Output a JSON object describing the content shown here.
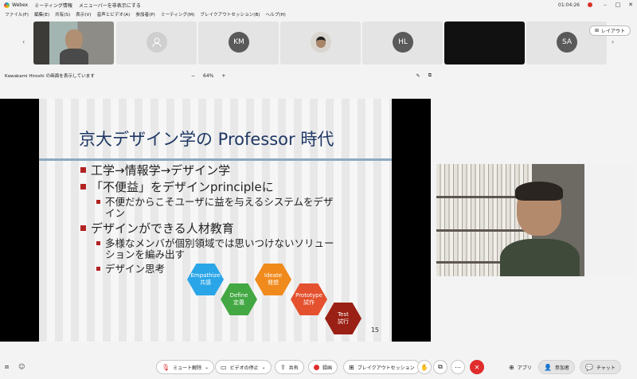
{
  "titlebar": {
    "app_name": "Webex",
    "tab_meeting": "ミーティング情報",
    "tab_hide_menu": "メニューバーを非表示にする",
    "time": "01:04:26"
  },
  "menubar": {
    "items": [
      "ファイル(F)",
      "編集(E)",
      "共有(S)",
      "表示(V)",
      "音声とビデオ(A)",
      "参加者(P)",
      "ミーティング(M)",
      "ブレイクアウトセッション(B)",
      "ヘルプ(H)"
    ]
  },
  "participants": {
    "tiles": [
      {
        "initials": ""
      },
      {
        "initials": "KM"
      },
      {
        "initials": ""
      },
      {
        "initials": "HL"
      },
      {
        "initials": ""
      },
      {
        "initials": "SA"
      }
    ],
    "layout_label": "レイアウト"
  },
  "share": {
    "status": "Kawakami Hiroshi の画面を表示しています",
    "zoom_level": "64%",
    "zoom_out": "−",
    "zoom_in": "+"
  },
  "slide": {
    "title": "京大デザイン学の Professor 時代",
    "bullets": [
      "工学→情報学→デザイン学",
      "「不便益」をデザインprincipleに",
      "デザインができる人材教育"
    ],
    "sub_bullets": [
      "不便だからこそユーザに益を与えるシステムをデザイン",
      "多様なメンバが個別領域では思いつけないソリューションを編み出す",
      "デザイン思考"
    ],
    "sub_line1": "不便だからこそユーザに益を与えるシステムをデザ",
    "sub_line1b": "イン",
    "sub_line2": "多様なメンバが個別領域では思いつけないソリュー",
    "sub_line2b": "ションを編み出す",
    "hexagons": [
      {
        "en": "Empathize",
        "ja": "共感",
        "color": "#2aa6e8"
      },
      {
        "en": "Define",
        "ja": "定義",
        "color": "#43a843"
      },
      {
        "en": "Ideate",
        "ja": "発想",
        "color": "#f08a1d"
      },
      {
        "en": "Prototype",
        "ja": "試作",
        "color": "#e4512e"
      },
      {
        "en": "Test",
        "ja": "試行",
        "color": "#9a1f14"
      }
    ],
    "page_number": "15"
  },
  "toolbar": {
    "mute": "ミュート解除",
    "video": "ビデオの停止",
    "share": "共有",
    "record": "録画",
    "breakout": "ブレイクアウトセッション",
    "apps": "アプリ",
    "participants": "参加者",
    "chat": "チャット"
  }
}
